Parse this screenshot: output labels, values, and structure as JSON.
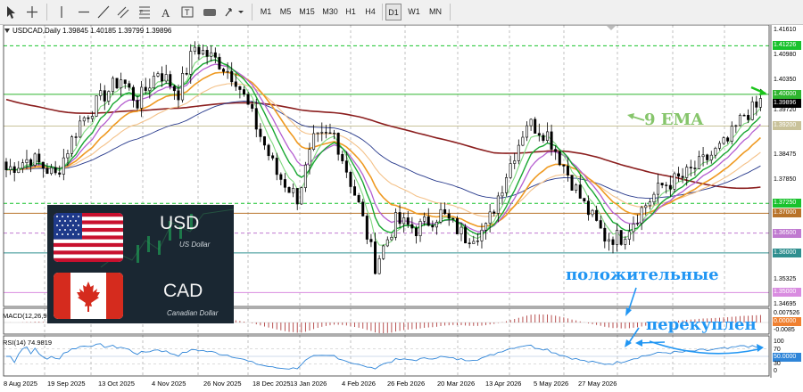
{
  "toolbar": {
    "timeframes": [
      "M1",
      "M5",
      "M15",
      "M30",
      "H1",
      "H4",
      "D1",
      "W1",
      "MN"
    ],
    "active_timeframe": "D1"
  },
  "chart": {
    "symbol_info": "USDCAD,Daily  1.39845 1.40185 1.39799 1.39896",
    "price_axis": [
      "1.41610",
      "1.41226",
      "1.40980",
      "1.40350",
      "1.40000",
      "1.39896",
      "1.39720",
      "1.39200",
      "1.38475",
      "1.37850",
      "1.37250",
      "1.37000",
      "1.36500",
      "1.36000",
      "1.35325",
      "1.35000",
      "1.34695"
    ],
    "date_axis": [
      "8 Aug 2025",
      "19 Sep 2025",
      "13 Oct 2025",
      "4 Nov 2025",
      "26 Nov 2025",
      "18 Dec 2025",
      "13 Jan 2026",
      "4 Feb 2026",
      "26 Feb 2026",
      "20 Mar 2026",
      "13 Apr 2026",
      "5 May 2026",
      "27 May 2026"
    ],
    "ylim": [
      1.3465,
      1.4175
    ],
    "levels": [
      {
        "price": 1.41226,
        "color": "#19c22d",
        "style": "dashed"
      },
      {
        "price": 1.4,
        "color": "#2fb52f",
        "style": "solid"
      },
      {
        "price": 1.392,
        "color": "#c9c29a",
        "style": "solid"
      },
      {
        "price": 1.3725,
        "color": "#19c22d",
        "style": "dashed"
      },
      {
        "price": 1.37,
        "color": "#b8732a",
        "style": "solid"
      },
      {
        "price": 1.365,
        "color": "#c07ad0",
        "style": "dashed"
      },
      {
        "price": 1.36,
        "color": "#2f8f8f",
        "style": "solid"
      },
      {
        "price": 1.35,
        "color": "#d98ce0",
        "style": "solid"
      }
    ]
  },
  "macd": {
    "label": "MACD(12,26,9)",
    "axis": [
      "0.007526",
      "0.00000",
      "-0.0085"
    ]
  },
  "rsi": {
    "label": "RSI(14) 74.9819",
    "axis": [
      "100",
      "70",
      "50.0000",
      "30",
      "0"
    ]
  },
  "flag_panel": {
    "usd_code": "USD",
    "usd_name": "US Dollar",
    "cad_code": "CAD",
    "cad_name": "Canadian Dollar"
  },
  "annotations": {
    "ema": "9 EMA",
    "positive": "положительные",
    "overbought": "перекуплен"
  },
  "colors": {
    "bull_candle": "#000000",
    "bear_candle": "#000000",
    "ema9": "#19a832",
    "ema_fast": "#7fd87f",
    "ema_purple": "#b55fd0",
    "ema_orange": "#ef9a22",
    "ema_peach": "#f4c188",
    "ma_maroon": "#8b1e1e",
    "ma_navy": "#283a8c",
    "macd_hist": "#b04040",
    "rsi_line": "#2f85d8",
    "annotation": "#2196f3"
  }
}
